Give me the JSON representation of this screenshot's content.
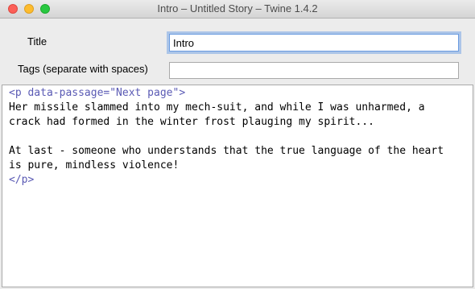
{
  "window": {
    "title": "Intro – Untitled Story – Twine 1.4.2"
  },
  "form": {
    "title_label": "Title",
    "title_value": "Intro",
    "tags_label": "Tags (separate with spaces)",
    "tags_value": ""
  },
  "editor": {
    "lines": [
      "<p data-passage=\"Next page\">",
      "Her missile slammed into my mech-suit, and while I was unharmed, a",
      "crack had formed in the winter frost plauging my spirit...",
      "",
      "At last - someone who understands that the true language of the heart",
      "is pure, mindless violence!",
      "</p>"
    ],
    "markup_color": "#5a5ab4"
  }
}
